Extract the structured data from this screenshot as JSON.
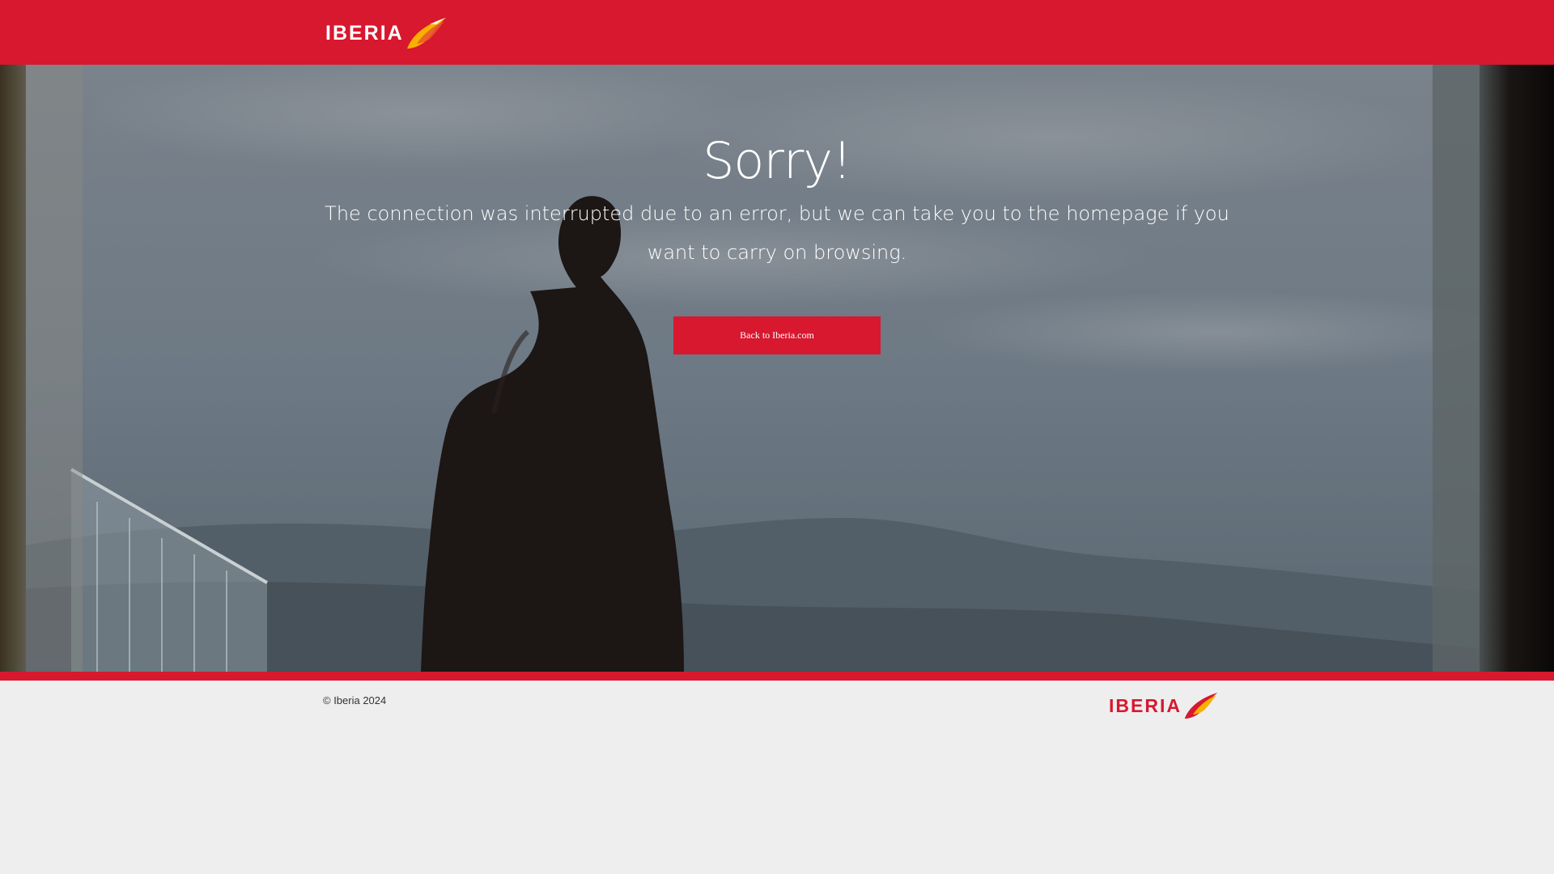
{
  "header": {
    "logo_text": "IBERIA"
  },
  "error": {
    "title": "Sorry!",
    "message": "The connection was interrupted due to an error, but we can take you to the homepage if you want to carry on browsing.",
    "back_button_label": "Back to Iberia.com"
  },
  "footer": {
    "copyright": "© Iberia 2024",
    "logo_text": "IBERIA"
  },
  "colors": {
    "brand_red": "#d7182f",
    "brand_yellow": "#f9b000",
    "footer_bg": "#efeeee"
  },
  "icons": {
    "logo_mark": "iberia-wing-icon"
  }
}
